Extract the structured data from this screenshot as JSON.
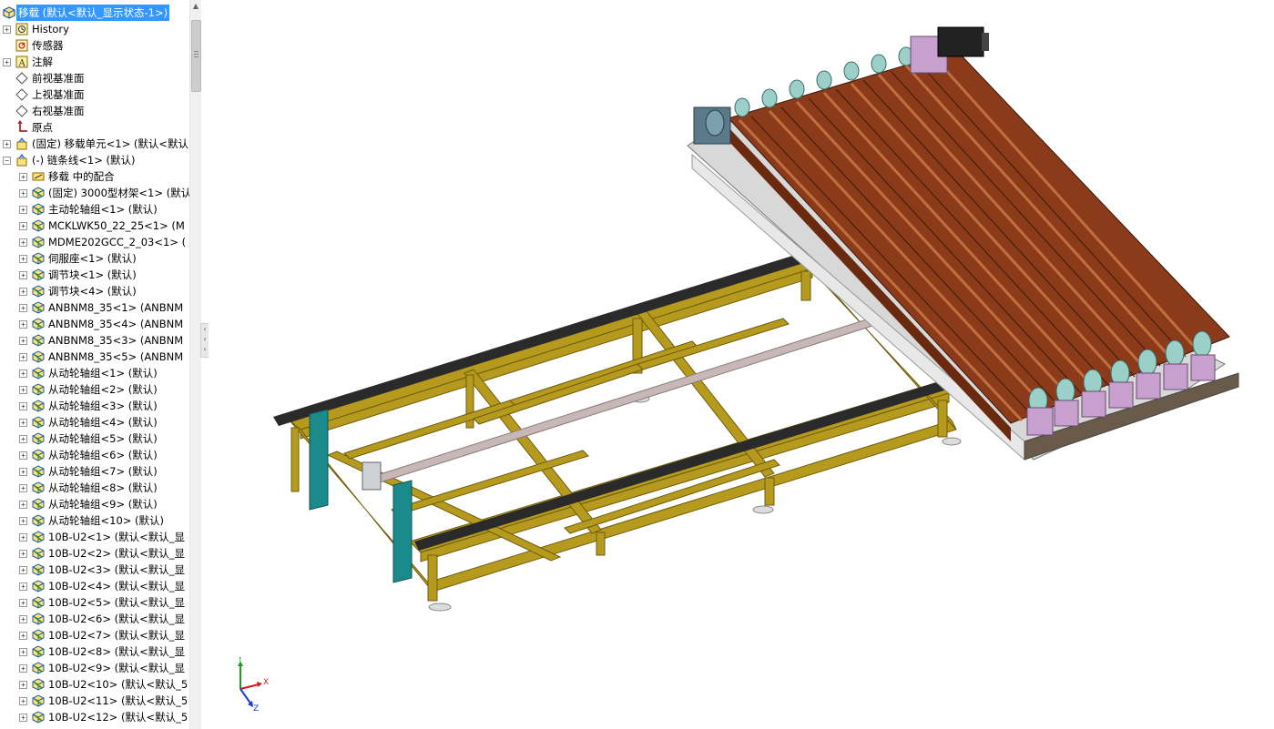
{
  "tree": {
    "root": "移载 (默认<默认_显示状态-1>)",
    "rows": [
      {
        "label": "History",
        "icon": "history-icon",
        "level": 0,
        "exp": "plus"
      },
      {
        "label": "传感器",
        "icon": "sensor-icon",
        "level": 0,
        "exp": ""
      },
      {
        "label": "注解",
        "icon": "annotation-icon",
        "level": 0,
        "exp": "plus"
      },
      {
        "label": "前视基准面",
        "icon": "plane-icon",
        "level": 0,
        "exp": ""
      },
      {
        "label": "上视基准面",
        "icon": "plane-icon",
        "level": 0,
        "exp": ""
      },
      {
        "label": "右视基准面",
        "icon": "plane-icon",
        "level": 0,
        "exp": ""
      },
      {
        "label": "原点",
        "icon": "origin-icon",
        "level": 0,
        "exp": ""
      },
      {
        "label": "(固定) 移载单元<1> (默认<默认",
        "icon": "subassembly-icon",
        "level": 0,
        "exp": "plus"
      },
      {
        "label": "(-) 链条线<1> (默认)",
        "icon": "subassembly-icon",
        "level": 0,
        "exp": "minus"
      },
      {
        "label": "移载 中的配合",
        "icon": "mates-icon",
        "level": 1,
        "exp": "plus"
      },
      {
        "label": "(固定) 3000型材架<1> (默认",
        "icon": "part-icon",
        "level": 1,
        "exp": "plus"
      },
      {
        "label": "主动轮轴组<1> (默认)",
        "icon": "part-icon",
        "level": 1,
        "exp": "plus"
      },
      {
        "label": "MCKLWK50_22_25<1> (M",
        "icon": "part-icon",
        "level": 1,
        "exp": "plus"
      },
      {
        "label": "MDME202GCC_2_03<1> (",
        "icon": "part-icon",
        "level": 1,
        "exp": "plus"
      },
      {
        "label": "伺服座<1> (默认)",
        "icon": "part-icon",
        "level": 1,
        "exp": "plus"
      },
      {
        "label": "调节块<1> (默认)",
        "icon": "part-icon",
        "level": 1,
        "exp": "plus"
      },
      {
        "label": "调节块<4> (默认)",
        "icon": "part-icon",
        "level": 1,
        "exp": "plus"
      },
      {
        "label": "ANBNM8_35<1> (ANBNM",
        "icon": "part-icon",
        "level": 1,
        "exp": "plus"
      },
      {
        "label": "ANBNM8_35<4> (ANBNM",
        "icon": "part-icon",
        "level": 1,
        "exp": "plus"
      },
      {
        "label": "ANBNM8_35<3> (ANBNM",
        "icon": "part-icon",
        "level": 1,
        "exp": "plus"
      },
      {
        "label": "ANBNM8_35<5> (ANBNM",
        "icon": "part-icon",
        "level": 1,
        "exp": "plus"
      },
      {
        "label": "从动轮轴组<1> (默认)",
        "icon": "part-icon",
        "level": 1,
        "exp": "plus"
      },
      {
        "label": "从动轮轴组<2> (默认)",
        "icon": "part-icon",
        "level": 1,
        "exp": "plus"
      },
      {
        "label": "从动轮轴组<3> (默认)",
        "icon": "part-icon",
        "level": 1,
        "exp": "plus"
      },
      {
        "label": "从动轮轴组<4> (默认)",
        "icon": "part-icon",
        "level": 1,
        "exp": "plus"
      },
      {
        "label": "从动轮轴组<5> (默认)",
        "icon": "part-icon",
        "level": 1,
        "exp": "plus"
      },
      {
        "label": "从动轮轴组<6> (默认)",
        "icon": "part-icon",
        "level": 1,
        "exp": "plus"
      },
      {
        "label": "从动轮轴组<7> (默认)",
        "icon": "part-icon",
        "level": 1,
        "exp": "plus"
      },
      {
        "label": "从动轮轴组<8> (默认)",
        "icon": "part-icon",
        "level": 1,
        "exp": "plus"
      },
      {
        "label": "从动轮轴组<9> (默认)",
        "icon": "part-icon",
        "level": 1,
        "exp": "plus"
      },
      {
        "label": "从动轮轴组<10> (默认)",
        "icon": "part-icon",
        "level": 1,
        "exp": "plus"
      },
      {
        "label": "10B-U2<1> (默认<默认_显",
        "icon": "part-icon",
        "level": 1,
        "exp": "plus"
      },
      {
        "label": "10B-U2<2> (默认<默认_显",
        "icon": "part-icon",
        "level": 1,
        "exp": "plus"
      },
      {
        "label": "10B-U2<3> (默认<默认_显",
        "icon": "part-icon",
        "level": 1,
        "exp": "plus"
      },
      {
        "label": "10B-U2<4> (默认<默认_显",
        "icon": "part-icon",
        "level": 1,
        "exp": "plus"
      },
      {
        "label": "10B-U2<5> (默认<默认_显",
        "icon": "part-icon",
        "level": 1,
        "exp": "plus"
      },
      {
        "label": "10B-U2<6> (默认<默认_显",
        "icon": "part-icon",
        "level": 1,
        "exp": "plus"
      },
      {
        "label": "10B-U2<7> (默认<默认_显",
        "icon": "part-icon",
        "level": 1,
        "exp": "plus"
      },
      {
        "label": "10B-U2<8> (默认<默认_显",
        "icon": "part-icon",
        "level": 1,
        "exp": "plus"
      },
      {
        "label": "10B-U2<9> (默认<默认_显",
        "icon": "part-icon",
        "level": 1,
        "exp": "plus"
      },
      {
        "label": "10B-U2<10> (默认<默认_5",
        "icon": "part-icon",
        "level": 1,
        "exp": "plus"
      },
      {
        "label": "10B-U2<11> (默认<默认_5",
        "icon": "part-icon",
        "level": 1,
        "exp": "plus"
      },
      {
        "label": "10B-U2<12> (默认<默认_5",
        "icon": "part-icon",
        "level": 1,
        "exp": "plus"
      }
    ]
  },
  "triad": {
    "x": "X",
    "y": "Y",
    "z": "Z"
  },
  "colors": {
    "selection": "#3399ff",
    "frame": "#b59a1e",
    "frame_dark": "#7a6710",
    "belt": "#8b3a1a",
    "belt_light": "#c06030",
    "rail": "#2a2a2a",
    "accent_teal": "#1a8a8a",
    "accent_purple": "#c8a0d0"
  }
}
